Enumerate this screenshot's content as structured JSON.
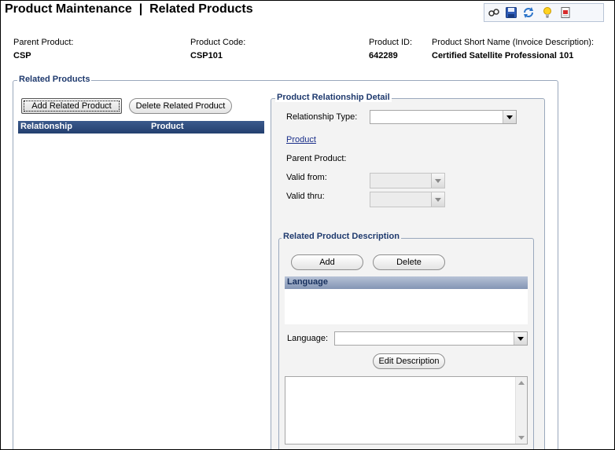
{
  "page": {
    "title": "Product Maintenance  |  Related Products"
  },
  "toolbar": {
    "icons": [
      "glasses-icon",
      "save-icon",
      "refresh-icon",
      "lightbulb-icon",
      "report-icon"
    ]
  },
  "header": {
    "parent_product_label": "Parent Product:",
    "parent_product_value": "CSP",
    "product_code_label": "Product Code:",
    "product_code_value": "CSP101",
    "product_id_label": "Product ID:",
    "product_id_value": "642289",
    "short_name_label": "Product Short Name (Invoice Description):",
    "short_name_value": "Certified Satellite Professional 101"
  },
  "related_products": {
    "title": "Related Products",
    "add_button": "Add Related Product",
    "delete_button": "Delete Related Product",
    "columns": [
      "Relationship",
      "Product"
    ],
    "rows": []
  },
  "detail": {
    "title": "Product Relationship Detail",
    "relationship_type_label": "Relationship Type:",
    "relationship_type_value": "",
    "product_link": "Product",
    "parent_product_label": "Parent Product:",
    "valid_from_label": "Valid from:",
    "valid_thru_label": "Valid thru:"
  },
  "description": {
    "title": "Related Product Description",
    "add_button": "Add",
    "delete_button": "Delete",
    "column": "Language",
    "language_label": "Language:",
    "language_value": "",
    "edit_button": "Edit Description",
    "description_text": ""
  },
  "colors": {
    "accent": "#1f3a6e",
    "grid_header": "#2b4a7c",
    "link": "#1a2f8a"
  }
}
